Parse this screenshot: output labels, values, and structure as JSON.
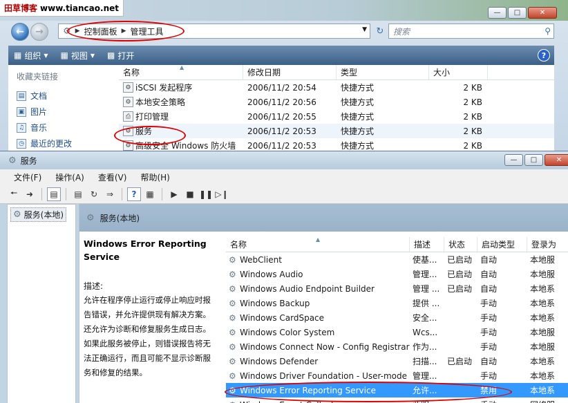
{
  "blog": {
    "name": "田草博客",
    "url": "www.tiancao.net"
  },
  "explorer": {
    "breadcrumb": [
      "控制面板",
      "管理工具"
    ],
    "search_placeholder": "搜索",
    "commands": [
      {
        "label": "组织",
        "icon": "organize-icon"
      },
      {
        "label": "视图",
        "icon": "views-icon"
      },
      {
        "label": "打开",
        "icon": "open-icon"
      }
    ],
    "favorites_title": "收藏夹链接",
    "favorites": [
      "文档",
      "图片",
      "音乐",
      "最近的更改"
    ],
    "columns": [
      "名称",
      "修改日期",
      "类型",
      "大小"
    ],
    "files": [
      {
        "name": "iSCSI 发起程序",
        "date": "2006/11/2 20:54",
        "type": "快捷方式",
        "size": "2 KB"
      },
      {
        "name": "本地安全策略",
        "date": "2006/11/2 20:56",
        "type": "快捷方式",
        "size": "2 KB"
      },
      {
        "name": "打印管理",
        "date": "2006/11/2 20:55",
        "type": "快捷方式",
        "size": "2 KB"
      },
      {
        "name": "服务",
        "date": "2006/11/2 20:53",
        "type": "快捷方式",
        "size": "2 KB"
      },
      {
        "name": "高级安全 Windows 防火墙",
        "date": "2006/11/2 20:53",
        "type": "快捷方式",
        "size": "2 KB"
      }
    ]
  },
  "services": {
    "title": "服务",
    "menus": [
      "文件(F)",
      "操作(A)",
      "查看(V)",
      "帮助(H)"
    ],
    "tree_item": "服务(本地)",
    "pane_header": "服务(本地)",
    "selected_name": "Windows Error Reporting Service",
    "desc_label": "描述:",
    "desc_lines": [
      "允许在程序停止运行或停止响应时报",
      "告错误，并允许提供现有解决方案。",
      "还允许为诊断和修复服务生成日志。",
      "如果此服务被停止，则错误报告将无",
      "法正确运行，而且可能不显示诊断服",
      "务和修复的结果。"
    ],
    "columns": [
      "名称",
      "描述",
      "状态",
      "启动类型",
      "登录为"
    ],
    "rows": [
      {
        "name": "WebClient",
        "desc": "使基...",
        "state": "已启动",
        "startup": "自动",
        "logon": "本地服"
      },
      {
        "name": "Windows Audio",
        "desc": "管理...",
        "state": "已启动",
        "startup": "自动",
        "logon": "本地服"
      },
      {
        "name": "Windows Audio Endpoint Builder",
        "desc": "管理 ...",
        "state": "已启动",
        "startup": "自动",
        "logon": "本地系"
      },
      {
        "name": "Windows Backup",
        "desc": "提供 ...",
        "state": "",
        "startup": "手动",
        "logon": "本地系"
      },
      {
        "name": "Windows CardSpace",
        "desc": "安全...",
        "state": "",
        "startup": "手动",
        "logon": "本地系"
      },
      {
        "name": "Windows Color System",
        "desc": "Wcs...",
        "state": "",
        "startup": "手动",
        "logon": "本地服"
      },
      {
        "name": "Windows Connect Now - Config Registrar",
        "desc": "作为...",
        "state": "",
        "startup": "手动",
        "logon": "本地服"
      },
      {
        "name": "Windows Defender",
        "desc": "扫描...",
        "state": "已启动",
        "startup": "自动",
        "logon": "本地系"
      },
      {
        "name": "Windows Driver Foundation - User-mode",
        "desc": "管理...",
        "state": "",
        "startup": "手动",
        "logon": "本地系"
      },
      {
        "name": "Windows Error Reporting Service",
        "desc": "允许...",
        "state": "",
        "startup": "禁用",
        "logon": "本地系"
      },
      {
        "name": "Windows Event Collector",
        "desc": "此服...",
        "state": "",
        "startup": "手动",
        "logon": "网络服"
      }
    ],
    "selected_row": 9
  },
  "colors": {
    "annotation": "#e00000",
    "selection": "#3399ff"
  }
}
